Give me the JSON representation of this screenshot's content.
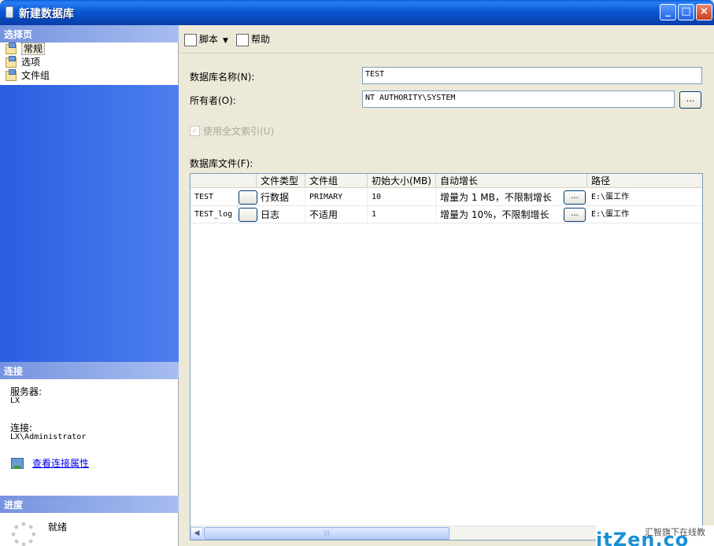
{
  "window": {
    "title": "新建数据库"
  },
  "left_pane": {
    "pages_header": "选择页",
    "pages": [
      {
        "label": "常规",
        "selected": true
      },
      {
        "label": "选项",
        "selected": false
      },
      {
        "label": "文件组",
        "selected": false
      }
    ],
    "connection_header": "连接",
    "server_label": "服务器:",
    "server_value": "LX",
    "connection_label": "连接:",
    "connection_value": "LX\\Administrator",
    "view_connection_link": "查看连接属性",
    "progress_header": "进度",
    "progress_status": "就绪"
  },
  "toolbar": {
    "script_label": "脚本",
    "help_label": "帮助"
  },
  "form": {
    "db_name_label": "数据库名称(N):",
    "db_name_value": "TEST",
    "owner_label": "所有者(O):",
    "owner_value": "NT AUTHORITY\\SYSTEM",
    "owner_browse": "...",
    "fulltext_label": "使用全文索引(U)",
    "fulltext_checked": true,
    "files_label": "数据库文件(F):"
  },
  "files_grid": {
    "columns": [
      "",
      "文件类型",
      "文件组",
      "初始大小(MB)",
      "自动增长",
      "路径"
    ],
    "rows": [
      {
        "logical_name": "TEST",
        "file_type": "行数据",
        "filegroup": "PRIMARY",
        "initial_size": "10",
        "autogrowth": "增量为 1 MB，不限制增长",
        "autogrowth_btn": "...",
        "path": "E:\\蛋工作"
      },
      {
        "logical_name": "TEST_log",
        "file_type": "日志",
        "filegroup": "不适用",
        "initial_size": "1",
        "autogrowth": "增量为 10%，不限制增长",
        "autogrowth_btn": "...",
        "path": "E:\\蛋工作"
      }
    ],
    "scroll_thumb_glyph": "|||"
  },
  "watermark": {
    "brand": "itZen.co",
    "tagline": "汇智旗下在线教"
  }
}
